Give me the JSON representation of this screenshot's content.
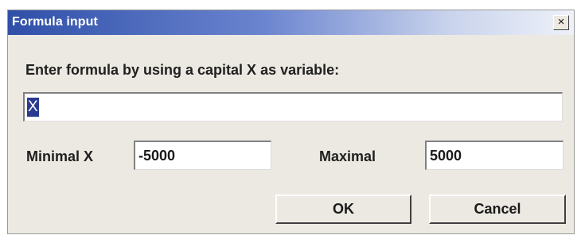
{
  "dialog": {
    "title": "Formula input",
    "close_glyph": "×",
    "close_icon": "close-icon"
  },
  "prompt": "Enter formula by using a capital X as variable:",
  "formula": {
    "value": "X",
    "selected": true
  },
  "range": {
    "min_label": "Minimal X",
    "min_value": "-5000",
    "max_label": "Maximal",
    "max_value": "5000"
  },
  "buttons": {
    "ok_label": "OK",
    "cancel_label": "Cancel"
  },
  "colors": {
    "titlebar_start": "#2f4fa8",
    "titlebar_end": "#eef1f9",
    "dialog_background": "#ece9e2",
    "selection": "#2a3b8f"
  }
}
